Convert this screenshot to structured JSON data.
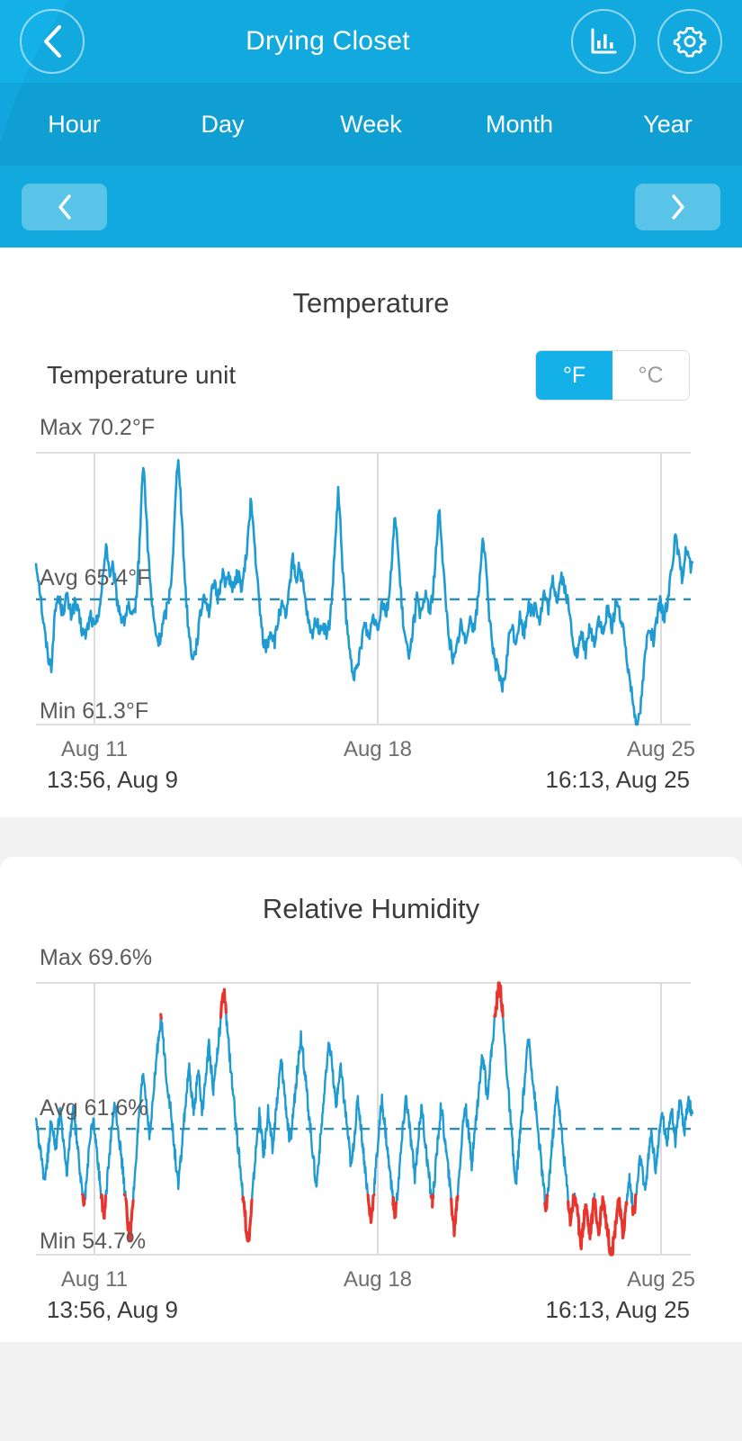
{
  "header": {
    "title": "Drying Closet",
    "back_icon": "chevron-left-icon",
    "stats_icon": "bar-chart-icon",
    "settings_icon": "gear-icon"
  },
  "tabs": [
    {
      "label": "Hour"
    },
    {
      "label": "Day"
    },
    {
      "label": "Week"
    },
    {
      "label": "Month"
    },
    {
      "label": "Year"
    }
  ],
  "pager": {
    "prev_icon": "chevron-left-icon",
    "next_icon": "chevron-right-icon"
  },
  "temperature": {
    "title": "Temperature",
    "unit_label": "Temperature unit",
    "units": [
      {
        "label": "°F",
        "selected": true
      },
      {
        "label": "°C",
        "selected": false
      }
    ],
    "max_label": "Max 70.2°F",
    "avg_label": "Avg 65.4°F",
    "min_label": "Min 61.3°F",
    "range_start": "13:56, Aug 9",
    "range_end": "16:13, Aug 25"
  },
  "humidity": {
    "title": "Relative Humidity",
    "max_label": "Max 69.6%",
    "avg_label": "Avg 61.6%",
    "min_label": "Min 54.7%",
    "range_start": "13:56, Aug 9",
    "range_end": "16:13, Aug 25"
  },
  "colors": {
    "brand_blue": "#06a5e0",
    "brand_blue_light": "#13b1e8",
    "series_blue": "#1f9bd4",
    "alert_red": "#e8342c",
    "card_bg": "#ffffff",
    "page_bg": "#f2f2f2",
    "text_dark": "#3c3c3c",
    "text_muted": "#6e6e6e"
  },
  "chart_data": [
    {
      "type": "line",
      "title": "Temperature",
      "ylabel": "°F",
      "xlabel": "",
      "unit": "°F",
      "grid": true,
      "legend": "none",
      "ylim": [
        61.3,
        70.2
      ],
      "stats": {
        "max": 70.2,
        "avg": 65.4,
        "min": 61.3
      },
      "avg_line": 65.4,
      "high_threshold": 69.9,
      "x_ticks": [
        "Aug 11",
        "Aug 18",
        "Aug 25"
      ],
      "x_tick_positions": [
        0.125,
        0.5625,
        1.0
      ],
      "x_start": "13:56, Aug 9",
      "x_end": "16:13, Aug 25",
      "series": [
        {
          "name": "Temperature",
          "color": "#1f9bd4",
          "values": [
            66.6,
            66.2,
            65.6,
            64.9,
            64.3,
            63.8,
            63.4,
            63.2,
            64.3,
            65.1,
            65.5,
            65.3,
            65.0,
            65.2,
            65.5,
            65.2,
            64.9,
            65.1,
            65.3,
            65.0,
            64.7,
            64.4,
            64.2,
            64.3,
            64.6,
            64.9,
            64.6,
            64.4,
            64.8,
            65.2,
            65.6,
            66.4,
            67.3,
            66.6,
            66.1,
            66.4,
            66.0,
            65.4,
            65.1,
            64.8,
            64.6,
            64.9,
            65.2,
            64.9,
            64.7,
            65.0,
            65.6,
            66.8,
            68.4,
            69.9,
            68.7,
            67.2,
            66.1,
            65.2,
            64.6,
            64.2,
            64.0,
            64.2,
            64.6,
            64.9,
            65.2,
            65.6,
            66.3,
            67.5,
            69.1,
            70.2,
            68.9,
            67.4,
            66.1,
            65.0,
            64.2,
            63.7,
            63.5,
            63.8,
            64.3,
            64.8,
            65.3,
            65.6,
            65.3,
            65.0,
            65.4,
            66.0,
            65.7,
            65.4,
            65.8,
            66.3,
            66.1,
            65.9,
            66.2,
            66.0,
            65.7,
            65.9,
            66.3,
            66.0,
            65.8,
            66.2,
            66.8,
            67.6,
            68.6,
            68.0,
            67.0,
            66.1,
            65.2,
            64.5,
            64.0,
            63.8,
            64.0,
            64.4,
            64.2,
            64.0,
            64.4,
            64.9,
            65.2,
            65.0,
            64.8,
            65.2,
            65.9,
            66.8,
            66.4,
            66.0,
            66.5,
            66.2,
            65.8,
            65.3,
            64.8,
            64.4,
            64.2,
            64.5,
            64.8,
            64.5,
            64.3,
            64.6,
            64.4,
            64.2,
            64.6,
            65.3,
            66.4,
            67.7,
            68.9,
            67.8,
            66.5,
            65.4,
            64.5,
            63.8,
            63.3,
            63.0,
            62.9,
            63.2,
            63.7,
            64.2,
            64.6,
            64.4,
            64.2,
            64.5,
            64.9,
            64.7,
            64.5,
            64.9,
            65.4,
            65.2,
            65.0,
            65.4,
            66.1,
            67.1,
            68.3,
            67.3,
            66.2,
            65.2,
            64.4,
            63.9,
            63.6,
            63.9,
            64.4,
            64.9,
            65.4,
            65.1,
            64.8,
            65.2,
            65.6,
            65.3,
            65.0,
            65.5,
            66.2,
            67.2,
            68.5,
            67.6,
            66.4,
            65.4,
            64.6,
            64.0,
            63.6,
            63.4,
            63.7,
            64.2,
            64.6,
            64.3,
            64.0,
            64.4,
            64.9,
            64.6,
            64.4,
            64.9,
            65.5,
            66.4,
            67.6,
            66.8,
            65.8,
            64.9,
            64.2,
            63.7,
            63.3,
            63.0,
            62.7,
            62.5,
            62.8,
            63.4,
            64.1,
            64.6,
            64.3,
            64.0,
            64.4,
            64.8,
            64.5,
            64.3,
            64.8,
            65.4,
            65.1,
            64.9,
            65.3,
            65.0,
            64.7,
            65.1,
            65.6,
            65.3,
            65.1,
            65.5,
            66.0,
            65.7,
            65.4,
            65.8,
            66.2,
            65.9,
            65.6,
            65.2,
            64.7,
            64.2,
            63.8,
            63.5,
            63.8,
            64.3,
            64.0,
            63.7,
            64.1,
            64.5,
            64.2,
            64.0,
            64.4,
            64.8,
            64.5,
            64.2,
            64.6,
            65.1,
            64.8,
            64.5,
            64.9,
            65.4,
            65.1,
            64.8,
            64.4,
            63.9,
            63.4,
            62.9,
            62.4,
            61.9,
            61.5,
            61.3,
            61.8,
            62.6,
            63.4,
            64.1,
            64.6,
            64.3,
            64.0,
            64.4,
            64.9,
            65.3,
            65.0,
            64.8,
            65.2,
            65.7,
            66.3,
            66.9,
            67.4,
            67.0,
            66.5,
            66.1,
            66.6,
            67.1,
            66.8,
            66.4
          ]
        }
      ]
    },
    {
      "type": "line",
      "title": "Relative Humidity",
      "ylabel": "%",
      "xlabel": "",
      "unit": "%",
      "grid": true,
      "legend": "none",
      "ylim": [
        54.7,
        69.6
      ],
      "stats": {
        "max": 69.6,
        "avg": 61.6,
        "min": 54.7
      },
      "avg_line": 61.6,
      "high_threshold": 67.5,
      "low_threshold": 58.0,
      "x_ticks": [
        "Aug 11",
        "Aug 18",
        "Aug 25"
      ],
      "x_tick_positions": [
        0.125,
        0.5625,
        1.0
      ],
      "x_start": "13:56, Aug 9",
      "x_end": "16:13, Aug 25",
      "series": [
        {
          "name": "Relative Humidity",
          "color": "#1f9bd4",
          "values": [
            62.0,
            61.2,
            60.3,
            59.4,
            58.7,
            59.6,
            61.0,
            62.2,
            61.4,
            60.5,
            61.6,
            62.4,
            61.5,
            60.2,
            59.1,
            60.4,
            61.8,
            62.6,
            61.7,
            60.6,
            59.4,
            58.2,
            57.4,
            58.6,
            60.1,
            61.4,
            62.2,
            61.3,
            60.1,
            59.0,
            57.8,
            56.9,
            57.9,
            59.4,
            60.8,
            62.0,
            63.1,
            62.2,
            61.1,
            60.0,
            58.9,
            57.6,
            56.4,
            55.7,
            57.0,
            58.8,
            60.6,
            62.1,
            63.4,
            64.6,
            63.5,
            62.3,
            61.2,
            62.5,
            64.0,
            65.4,
            66.6,
            67.8,
            66.5,
            65.2,
            64.0,
            63.1,
            62.0,
            60.8,
            59.6,
            58.4,
            59.7,
            61.2,
            62.6,
            63.8,
            64.8,
            63.6,
            62.4,
            63.6,
            64.8,
            63.7,
            62.5,
            63.8,
            65.1,
            66.2,
            65.0,
            63.8,
            64.9,
            66.1,
            67.2,
            68.4,
            69.0,
            67.6,
            66.2,
            64.8,
            63.5,
            62.2,
            61.0,
            59.8,
            58.6,
            57.4,
            56.2,
            55.4,
            56.6,
            58.2,
            59.8,
            61.2,
            62.4,
            61.3,
            60.1,
            61.4,
            62.6,
            61.5,
            60.4,
            61.7,
            63.0,
            64.2,
            65.4,
            64.2,
            63.0,
            61.8,
            60.6,
            61.9,
            63.2,
            64.4,
            65.6,
            66.8,
            65.6,
            64.4,
            63.2,
            62.0,
            60.8,
            59.6,
            58.4,
            59.8,
            61.2,
            62.6,
            63.9,
            65.2,
            66.4,
            65.2,
            64.0,
            62.8,
            63.9,
            65.0,
            64.0,
            62.9,
            61.8,
            60.6,
            59.4,
            60.7,
            62.0,
            63.2,
            62.2,
            61.0,
            59.8,
            58.6,
            57.4,
            56.6,
            57.8,
            59.2,
            60.6,
            62.0,
            63.2,
            62.1,
            61.0,
            59.9,
            58.8,
            57.7,
            56.8,
            58.0,
            59.4,
            60.8,
            62.2,
            63.4,
            62.3,
            61.2,
            60.1,
            59.0,
            60.3,
            61.6,
            62.8,
            61.7,
            60.6,
            59.5,
            58.4,
            57.6,
            58.8,
            60.2,
            61.6,
            62.9,
            61.8,
            60.7,
            59.6,
            58.5,
            57.2,
            56.0,
            57.3,
            58.8,
            60.3,
            61.8,
            63.0,
            61.9,
            60.8,
            59.7,
            60.9,
            62.2,
            63.4,
            64.6,
            65.8,
            64.6,
            63.4,
            64.6,
            65.8,
            67.0,
            68.1,
            69.2,
            69.6,
            68.0,
            66.4,
            64.8,
            63.2,
            61.6,
            60.0,
            58.4,
            59.8,
            61.2,
            62.6,
            64.0,
            65.4,
            66.6,
            65.4,
            64.2,
            63.0,
            61.8,
            60.6,
            59.4,
            58.2,
            57.0,
            58.4,
            59.8,
            61.2,
            62.6,
            63.8,
            62.6,
            61.4,
            60.2,
            59.0,
            57.8,
            56.6,
            57.4,
            58.2,
            57.2,
            56.2,
            55.4,
            56.4,
            57.6,
            56.6,
            55.8,
            56.8,
            57.8,
            56.8,
            55.9,
            56.9,
            57.9,
            56.9,
            56.0,
            55.2,
            54.7,
            55.6,
            56.8,
            57.8,
            56.8,
            55.8,
            56.8,
            57.9,
            58.9,
            57.9,
            56.9,
            57.9,
            59.0,
            60.1,
            59.1,
            58.1,
            59.2,
            60.4,
            61.4,
            60.4,
            59.4,
            60.5,
            61.6,
            62.6,
            61.6,
            60.7,
            61.8,
            62.9,
            61.9,
            61.0,
            62.1,
            63.2,
            62.2,
            61.4,
            62.4,
            63.4,
            62.6
          ]
        }
      ]
    }
  ]
}
